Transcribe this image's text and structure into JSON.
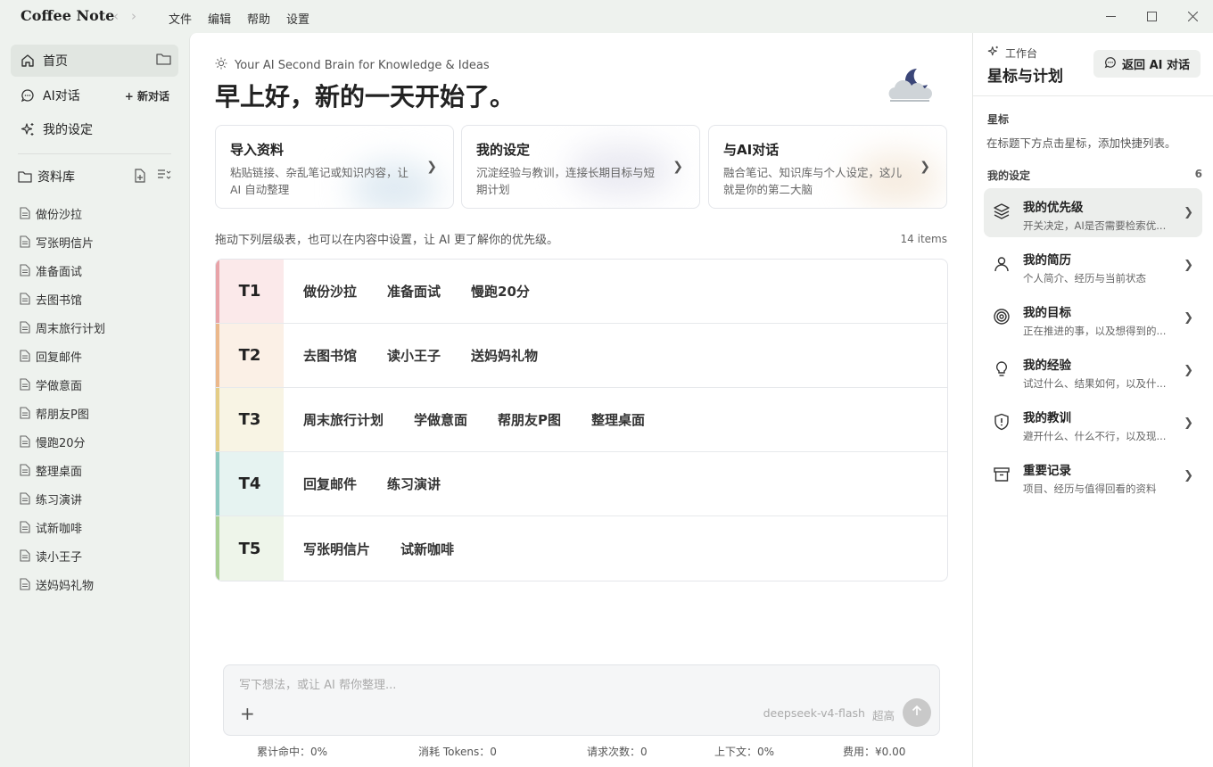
{
  "app": {
    "title": "Coffee Note"
  },
  "menu": [
    "文件",
    "编辑",
    "帮助",
    "设置"
  ],
  "sidebar": {
    "home": "首页",
    "ai_chat": "AI对话",
    "new_chat": "+ 新对话",
    "my_settings": "我的设定",
    "library": "资料库",
    "docs": [
      "做份沙拉",
      "写张明信片",
      "准备面试",
      "去图书馆",
      "周末旅行计划",
      "回复邮件",
      "学做意面",
      "帮朋友P图",
      "慢跑20分",
      "整理桌面",
      "练习演讲",
      "试新咖啡",
      "读小王子",
      "送妈妈礼物"
    ]
  },
  "main": {
    "tagline": "Your AI Second Brain for Knowledge & Ideas",
    "greeting": "早上好，新的一天开始了。",
    "cards": [
      {
        "title": "导入资料",
        "desc": "粘贴链接、杂乱笔记或知识内容，让 AI 自动整理"
      },
      {
        "title": "我的设定",
        "desc": "沉淀经验与教训，连接长期目标与短期计划"
      },
      {
        "title": "与AI对话",
        "desc": "融合笔记、知识库与个人设定，这儿就是你的第二大脑"
      }
    ],
    "hint": "拖动下列层级表，也可以在内容中设置，让 AI 更了解你的优先级。",
    "count": "14 items",
    "tiers": [
      {
        "label": "T1",
        "color": "#e8a3a8",
        "bg": "#fbe9ea",
        "items": [
          "做份沙拉",
          "准备面试",
          "慢跑20分"
        ]
      },
      {
        "label": "T2",
        "color": "#ebb88b",
        "bg": "#fbf0e6",
        "items": [
          "去图书馆",
          "读小王子",
          "送妈妈礼物"
        ]
      },
      {
        "label": "T3",
        "color": "#e4cd86",
        "bg": "#f8f4e4",
        "items": [
          "周末旅行计划",
          "学做意面",
          "帮朋友P图",
          "整理桌面"
        ]
      },
      {
        "label": "T4",
        "color": "#8ec9c0",
        "bg": "#e6f3f1",
        "items": [
          "回复邮件",
          "练习演讲"
        ]
      },
      {
        "label": "T5",
        "color": "#a9cf94",
        "bg": "#eef5ea",
        "items": [
          "写张明信片",
          "试新咖啡"
        ]
      }
    ],
    "composer": {
      "placeholder": "写下想法，或让 AI 帮你整理...",
      "model": "deepseek-v4-flash",
      "level": "超高"
    },
    "stats": {
      "hit": "累计命中：0%",
      "tokens": "消耗 Tokens：0",
      "requests": "请求次数：0",
      "context": "上下文：0%",
      "cost": "费用：¥0.00"
    }
  },
  "right": {
    "workspace": "工作台",
    "title": "星标与计划",
    "back": "返回 AI 对话",
    "star_heading": "星标",
    "star_desc": "在标题下方点击星标，添加快捷列表。",
    "settings_heading": "我的设定",
    "settings_count": "6",
    "items": [
      {
        "title": "我的优先级",
        "desc": "开关决定，AI是否需要检索优...",
        "icon": "layers-icon"
      },
      {
        "title": "我的简历",
        "desc": "个人简介、经历与当前状态",
        "icon": "user-icon"
      },
      {
        "title": "我的目标",
        "desc": "正在推进的事，以及想得到的...",
        "icon": "target-icon"
      },
      {
        "title": "我的经验",
        "desc": "试过什么、结果如何，以及什...",
        "icon": "lightbulb-icon"
      },
      {
        "title": "我的教训",
        "desc": "避开什么、什么不行，以及现...",
        "icon": "shield-alert-icon"
      },
      {
        "title": "重要记录",
        "desc": "项目、经历与值得回看的资料",
        "icon": "archive-icon"
      }
    ]
  }
}
